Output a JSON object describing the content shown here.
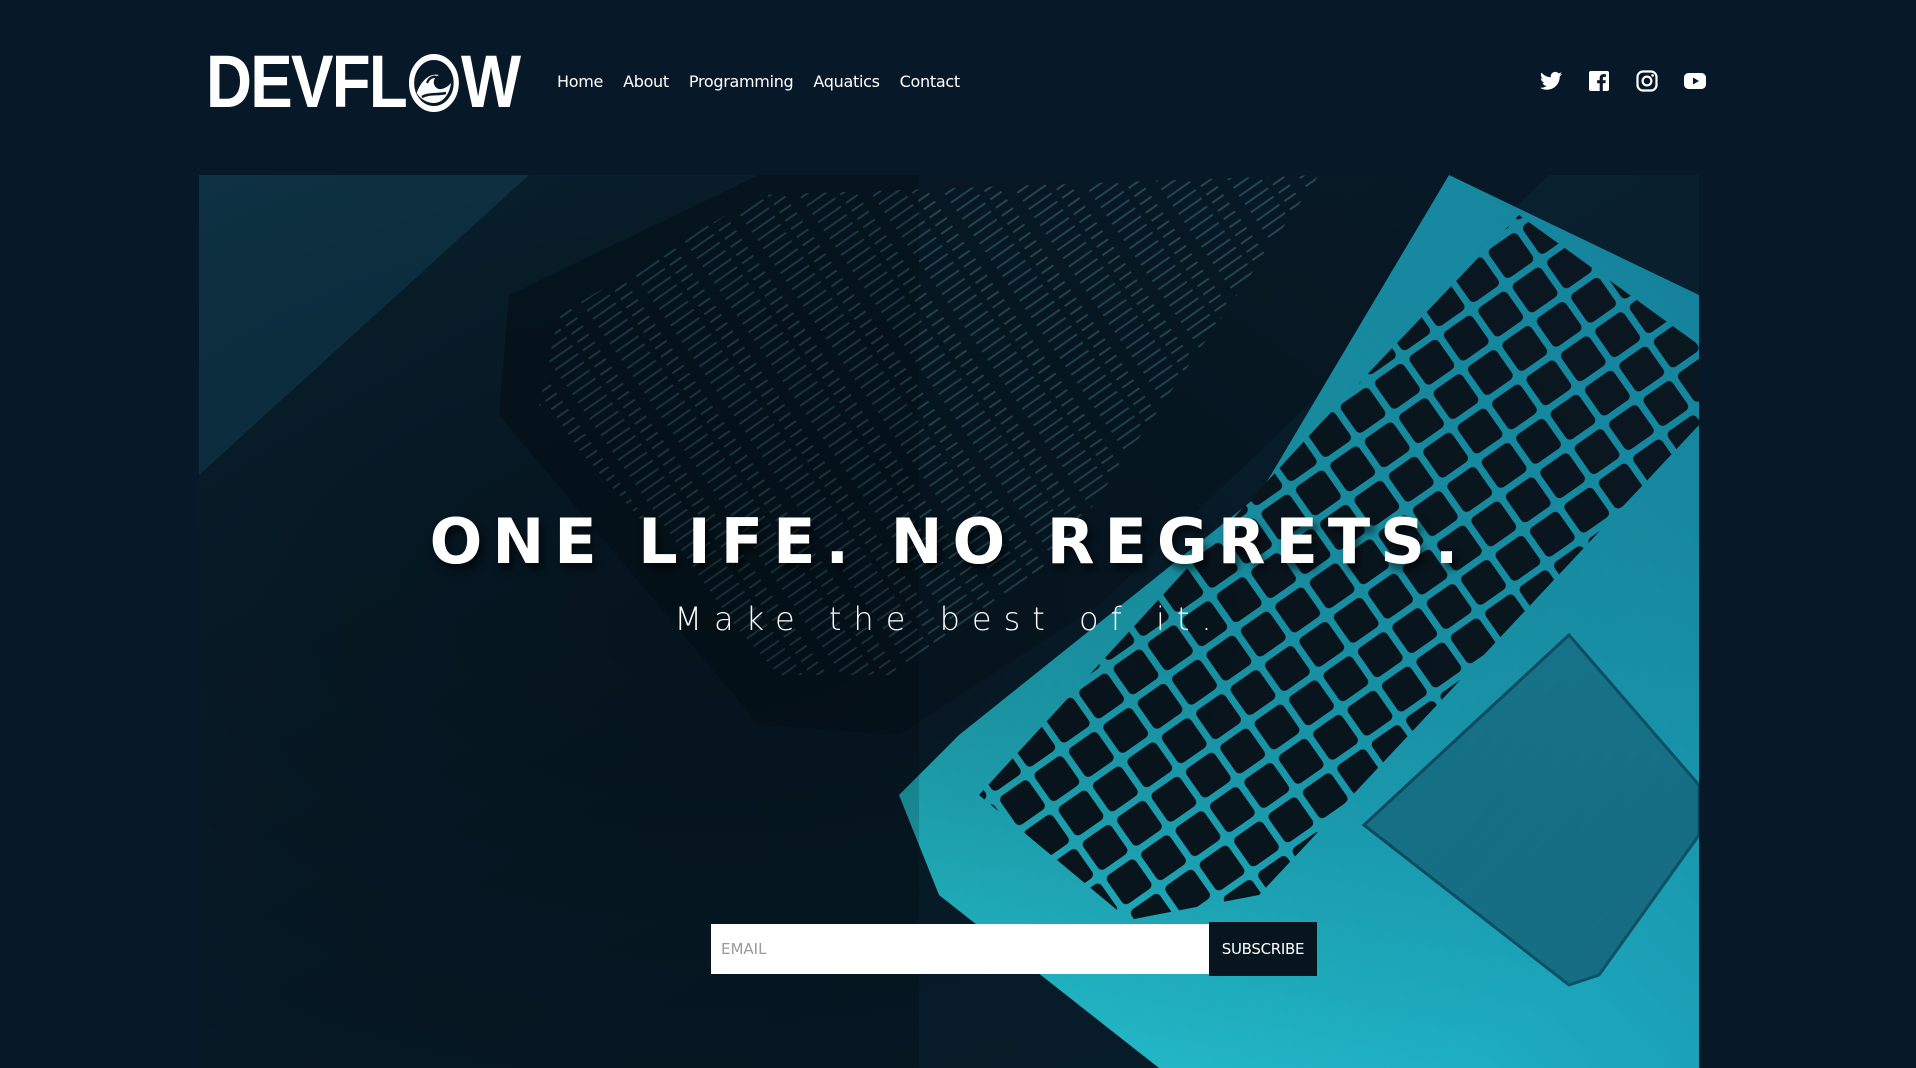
{
  "brand": {
    "logo_text_prefix": "DEVFL",
    "logo_text_suffix": "W",
    "logo_mark": "wave-icon"
  },
  "nav": {
    "items": [
      {
        "label": "Home"
      },
      {
        "label": "About"
      },
      {
        "label": "Programming"
      },
      {
        "label": "Aquatics"
      },
      {
        "label": "Contact"
      }
    ]
  },
  "social": {
    "icons": [
      "twitter-icon",
      "facebook-icon",
      "instagram-icon",
      "youtube-icon"
    ]
  },
  "hero": {
    "title": "ONE LIFE. NO REGRETS.",
    "subtitle": "Make the best of it.",
    "image": "laptop-keyboard-code-photo"
  },
  "subscribe": {
    "email_placeholder": "EMAIL",
    "email_value": "",
    "button_label": "SUBSCRIBE"
  },
  "colors": {
    "background": "#071828",
    "accent": "#3de3f0",
    "button": "#07151f"
  }
}
